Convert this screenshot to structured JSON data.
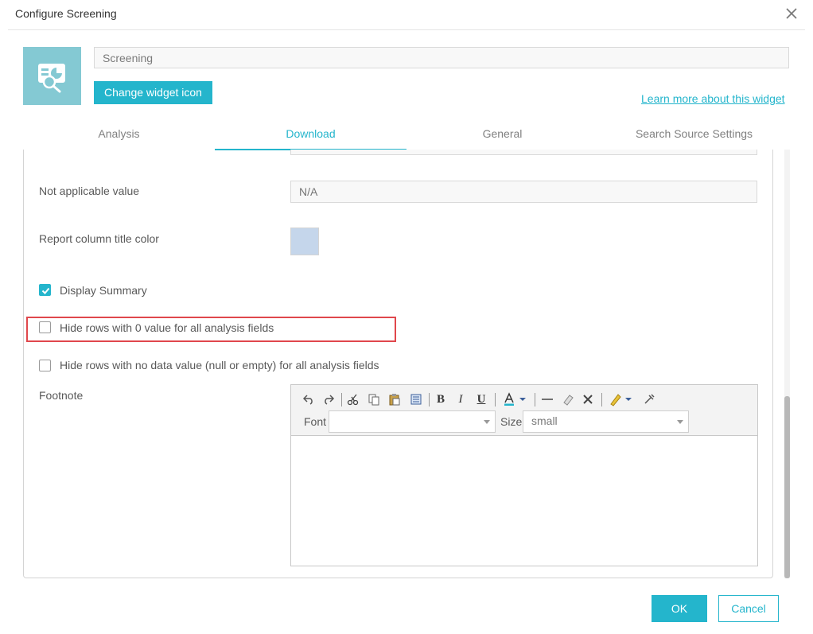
{
  "dialog": {
    "title": "Configure Screening"
  },
  "widget": {
    "name_value": "Screening",
    "change_icon_label": "Change widget icon",
    "learn_more_label": "Learn more about this widget",
    "icon": "screening-widget-icon"
  },
  "tabs": [
    {
      "label": "Analysis",
      "active": false
    },
    {
      "label": "Download",
      "active": true
    },
    {
      "label": "General",
      "active": false
    },
    {
      "label": "Search Source Settings",
      "active": false
    }
  ],
  "download": {
    "not_applicable_label": "Not applicable value",
    "not_applicable_placeholder": "N/A",
    "column_title_color_label": "Report column title color",
    "column_title_color": "#c5d6eb",
    "display_summary_label": "Display Summary",
    "display_summary_checked": true,
    "hide_zero_rows_label": "Hide rows with 0 value for all analysis fields",
    "hide_zero_rows_checked": false,
    "hide_nodata_rows_label": "Hide rows with no data value (null or empty) for all analysis fields",
    "hide_nodata_rows_checked": false,
    "footnote_label": "Footnote"
  },
  "editor": {
    "font_label": "Font",
    "font_value": "",
    "size_label": "Size",
    "size_value": "small",
    "toolbar_icons": [
      "undo-icon",
      "redo-icon",
      "cut-icon",
      "copy-icon",
      "paste-icon",
      "paste-text-icon",
      "bold-icon",
      "italic-icon",
      "underline-icon",
      "font-color-icon",
      "horizontal-rule-icon",
      "eraser-icon",
      "remove-format-icon",
      "highlight-color-icon",
      "link-icon"
    ]
  },
  "footer": {
    "ok_label": "OK",
    "cancel_label": "Cancel"
  },
  "colors": {
    "accent": "#24b5cc",
    "highlight_border": "#e0474c",
    "icon_bg": "#84c9d3"
  }
}
